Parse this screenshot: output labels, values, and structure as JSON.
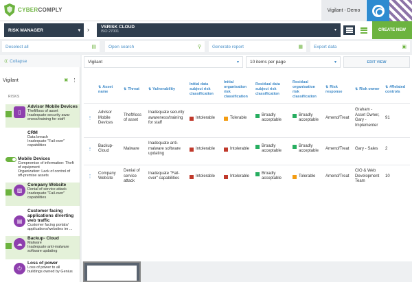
{
  "header": {
    "logo_text_a": "CYBER",
    "logo_text_b": "COMPLY",
    "user": "Vigilant - Demo",
    "colors": {
      "brand_green": "#6cb33f",
      "nav_dark": "#2f3e4e",
      "accent_blue": "#2e8bd0"
    }
  },
  "nav": {
    "module": "RISK MANAGER",
    "system_title": "VSRISK CLOUD",
    "system_sub": "ISO 27001",
    "create_label": "CREATE NEW"
  },
  "actions": {
    "deselect": "Deselect all",
    "search": "Open search",
    "report": "Generate report",
    "export": "Export data"
  },
  "sidebar": {
    "collapse": "Collapse",
    "project": "Vigilant",
    "risks_label": "RISKS",
    "risks": [
      {
        "title": "Advisor Mobile Devices",
        "lines": [
          "Theft/loss of asset",
          "Inadequate security awar",
          "eness/training for staff"
        ],
        "icon": "mobile-icon"
      },
      {
        "title": "CRM",
        "lines": [
          "Data breach",
          "Inadequate \"Fail-over\"",
          "capabilities"
        ],
        "icon": "database-icon"
      },
      {
        "title": "Mobile Devices",
        "lines": [
          "Compromise of information: Theft",
          "of equipment",
          "Organization: Lack of control of",
          "off-premise assets"
        ],
        "icon": "toggle-icon"
      },
      {
        "title": "Company Website",
        "lines": [
          "Denial of service attack",
          "Inadequate \"Fail-over\"",
          "capabilities"
        ],
        "icon": "website-icon"
      },
      {
        "title": "Customer facing applications diverting web traffic",
        "lines": [
          "Customer facing portals/",
          "applications/websites im ..."
        ],
        "icon": "book-icon"
      },
      {
        "title": "Backup- Cloud",
        "lines": [
          "Malware",
          "Inadequate anti-malware",
          "software updating"
        ],
        "icon": "cloud-icon"
      },
      {
        "title": "Loss of power",
        "lines": [
          "Loss of power to all",
          "buildings owned by Genius"
        ],
        "icon": "power-icon"
      }
    ]
  },
  "filters": {
    "asset": "Vigilant",
    "per_page": "10 items per page",
    "edit_view": "EDIT VIEW"
  },
  "table": {
    "headers": [
      "Asset name",
      "Threat",
      "Vulnerability",
      "Initial data subject risk classification",
      "Initial organisation risk classification",
      "Residual data subject risk classification",
      "Residual organisation risk classification",
      "Risk response",
      "Risk owner",
      "#Related controls"
    ],
    "rows": [
      {
        "asset": "Advisor Mobile Devices",
        "threat": "Theft/loss of asset",
        "vulnerability": "Inadequate security awareness/training for staff",
        "init_ds": {
          "label": "Intolerable",
          "color": "#c0392b"
        },
        "init_org": {
          "label": "Tolerable",
          "color": "#f39c12"
        },
        "res_ds": {
          "label": "Broadly acceptable",
          "color": "#27ae60"
        },
        "res_org": {
          "label": "Broadly acceptable",
          "color": "#27ae60"
        },
        "response": "Amend/Treat",
        "owner": "Graham - Asset Owner, Gary - Implementer",
        "controls": "91"
      },
      {
        "asset": "Backup- Cloud",
        "threat": "Malware",
        "vulnerability": "Inadequate anti-malware software updating",
        "init_ds": {
          "label": "Intolerable",
          "color": "#c0392b"
        },
        "init_org": {
          "label": "Intolerable",
          "color": "#c0392b"
        },
        "res_ds": {
          "label": "Broadly acceptable",
          "color": "#27ae60"
        },
        "res_org": {
          "label": "Broadly acceptable",
          "color": "#27ae60"
        },
        "response": "Amend/Treat",
        "owner": "Gary - Sales",
        "controls": "2"
      },
      {
        "asset": "Company Website",
        "threat": "Denial of service attack",
        "vulnerability": "Inadequate \"Fail-over\" capabilities",
        "init_ds": {
          "label": "Intolerable",
          "color": "#c0392b"
        },
        "init_org": {
          "label": "Intolerable",
          "color": "#c0392b"
        },
        "res_ds": {
          "label": "Broadly acceptable",
          "color": "#27ae60"
        },
        "res_org": {
          "label": "Tolerable",
          "color": "#f39c12"
        },
        "response": "Amend/Treat",
        "owner": "CIO & Web Development Team",
        "controls": "10"
      }
    ]
  }
}
